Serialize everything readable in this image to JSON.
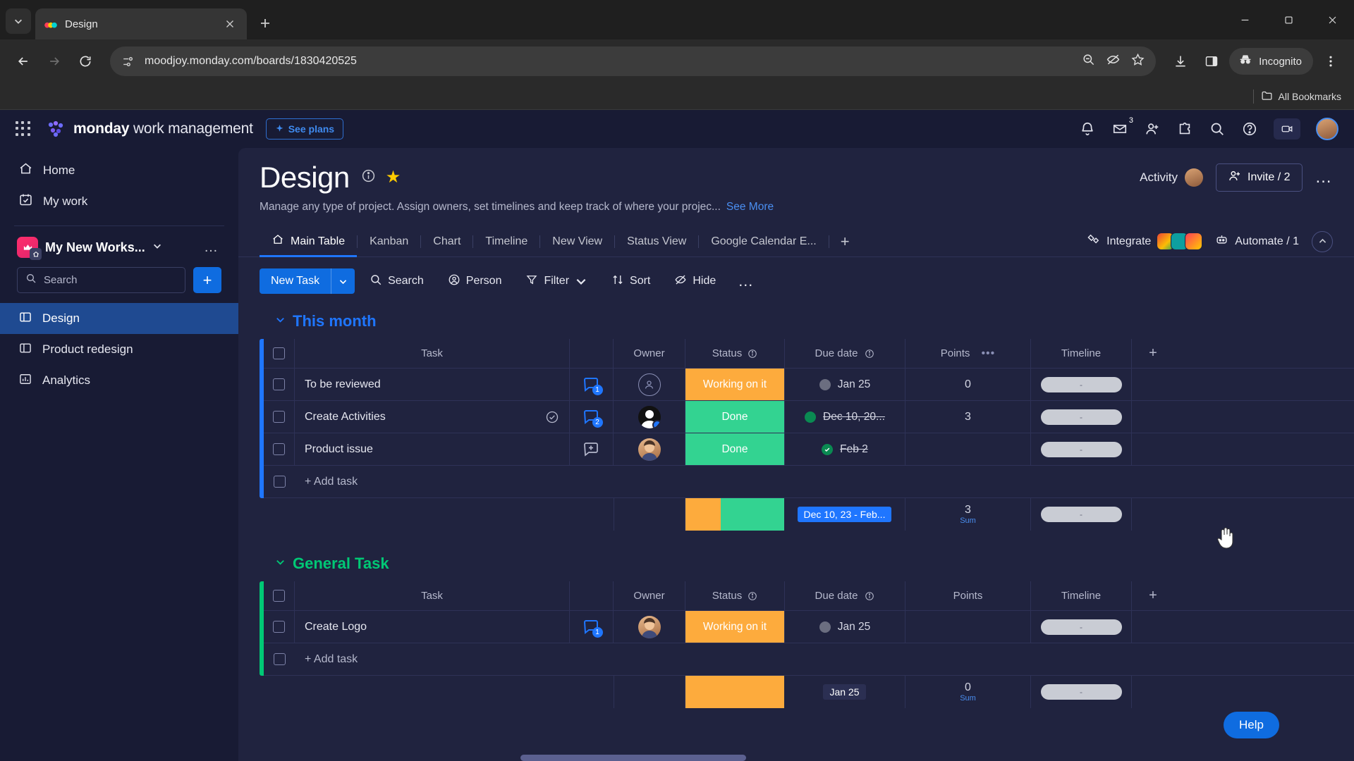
{
  "browser": {
    "tab": {
      "title": "Design",
      "favicon": "monday-icon",
      "close_icon": "close-icon"
    },
    "tab_list_icon": "chevron-down-icon",
    "new_tab_icon": "plus-icon",
    "window": {
      "minimize": "minimize-icon",
      "maximize": "maximize-icon",
      "close": "close-icon"
    },
    "nav": {
      "back": "back-arrow-icon",
      "forward": "forward-arrow-icon",
      "reload": "reload-icon"
    },
    "omnibox": {
      "url": "moodjoy.monday.com/boards/1830420525",
      "site_icon": "page-settings-icon",
      "zoom_out_icon": "zoom-out-icon",
      "tracking_icon": "eye-off-icon",
      "bookmark_icon": "star-icon"
    },
    "toolbar": {
      "downloads_icon": "download-icon",
      "sidepanel_icon": "side-panel-icon",
      "incognito_label": "Incognito",
      "incognito_icon": "incognito-icon",
      "menu_icon": "kebab-menu-icon"
    },
    "bookmarks": {
      "all_label": "All Bookmarks",
      "folder_icon": "folder-icon"
    }
  },
  "topbar": {
    "apps_icon": "app-grid-icon",
    "brand_bold": "monday",
    "brand_rest": " work management",
    "see_plans": "See plans",
    "icons": {
      "notifications": "bell-icon",
      "inbox": "inbox-icon",
      "inbox_count": "3",
      "invite": "add-person-icon",
      "apps": "puzzle-icon",
      "search": "search-icon",
      "help": "help-icon",
      "camera": "camera-icon"
    },
    "avatar": "user-avatar"
  },
  "sidebar": {
    "links": [
      {
        "label": "Home",
        "icon": "home-icon"
      },
      {
        "label": "My work",
        "icon": "calendar-check-icon"
      }
    ],
    "workspace": {
      "name": "My New Works...",
      "chevron": "chevron-down-icon",
      "more": "…",
      "avatar_icon": "crown-icon",
      "home_badge": "home-icon"
    },
    "search": {
      "placeholder": "Search",
      "icon": "search-icon"
    },
    "add_button": "+",
    "boards": [
      {
        "label": "Design",
        "icon": "board-icon",
        "active": true
      },
      {
        "label": "Product redesign",
        "icon": "board-icon",
        "active": false
      },
      {
        "label": "Analytics",
        "icon": "chart-icon",
        "active": false
      }
    ]
  },
  "board": {
    "title": "Design",
    "info_icon": "info-icon",
    "star_icon": "star-filled-icon",
    "description": "Manage any type of project. Assign owners, set timelines and keep track of where your projec...",
    "see_more": "See More",
    "activity_label": "Activity",
    "invite_label": "Invite / 2",
    "invite_icon": "add-person-icon",
    "more_icon": "…"
  },
  "views": {
    "tabs": [
      {
        "label": "Main Table",
        "icon": "home-icon",
        "active": true
      },
      {
        "label": "Kanban",
        "active": false
      },
      {
        "label": "Chart",
        "active": false
      },
      {
        "label": "Timeline",
        "active": false
      },
      {
        "label": "New View",
        "active": false
      },
      {
        "label": "Status View",
        "active": false
      },
      {
        "label": "Google Calendar E...",
        "active": false
      }
    ],
    "add_tab": "+",
    "integrate": {
      "label": "Integrate",
      "icon": "integrate-icon"
    },
    "automate": {
      "label": "Automate / 1",
      "icon": "robot-icon"
    },
    "collapse_icon": "chevron-up-icon"
  },
  "actionbar": {
    "new_task": "New Task",
    "new_task_arrow": "chevron-down-icon",
    "items": [
      {
        "label": "Search",
        "icon": "search-icon"
      },
      {
        "label": "Person",
        "icon": "person-icon"
      },
      {
        "label": "Filter",
        "icon": "filter-icon",
        "chevron": true
      },
      {
        "label": "Sort",
        "icon": "sort-icon"
      },
      {
        "label": "Hide",
        "icon": "eye-off-icon"
      }
    ],
    "more": "…"
  },
  "table": {
    "columns": [
      "Task",
      "Owner",
      "Status",
      "Due date",
      "Points",
      "Timeline"
    ],
    "add_column": "+",
    "add_task_label": "+ Add task",
    "groups": [
      {
        "name": "This month",
        "color": "#1f76ff",
        "collapse_icon": "chevron-down-icon",
        "rows": [
          {
            "task": "To be reviewed",
            "conversations": "1",
            "owner": "empty-avatar",
            "status": "Working on it",
            "status_color": "#fdab3d",
            "due_date": "Jan 25",
            "date_done": false,
            "points": "0",
            "timeline": "-"
          },
          {
            "task": "Create Activities",
            "done_check": true,
            "conversations": "2",
            "owner": "person-avatar",
            "status": "Done",
            "status_color": "#33d391",
            "due_date": "Dec 10, 20...",
            "date_done": true,
            "points": "3",
            "timeline": "-"
          },
          {
            "task": "Product issue",
            "conversations": "add",
            "owner": "person-avatar",
            "status": "Done",
            "status_color": "#33d391",
            "due_date": "Feb 2",
            "date_done": true,
            "points": "",
            "timeline": "-"
          }
        ],
        "summary": {
          "date_chip": "Dec 10, 23 - Feb...",
          "points_value": "3",
          "points_label": "Sum",
          "timeline": "-"
        }
      },
      {
        "name": "General Task",
        "color": "#00c875",
        "collapse_icon": "chevron-down-icon",
        "rows": [
          {
            "task": "Create Logo",
            "conversations": "1",
            "owner": "person-avatar",
            "status": "Working on it",
            "status_color": "#fdab3d",
            "due_date": "Jan 25",
            "date_done": false,
            "points": "",
            "timeline": "-"
          }
        ],
        "summary": {
          "date_chip": "Jan 25",
          "points_value": "0",
          "points_label": "Sum",
          "timeline": "-"
        }
      }
    ]
  },
  "help_button": "Help"
}
